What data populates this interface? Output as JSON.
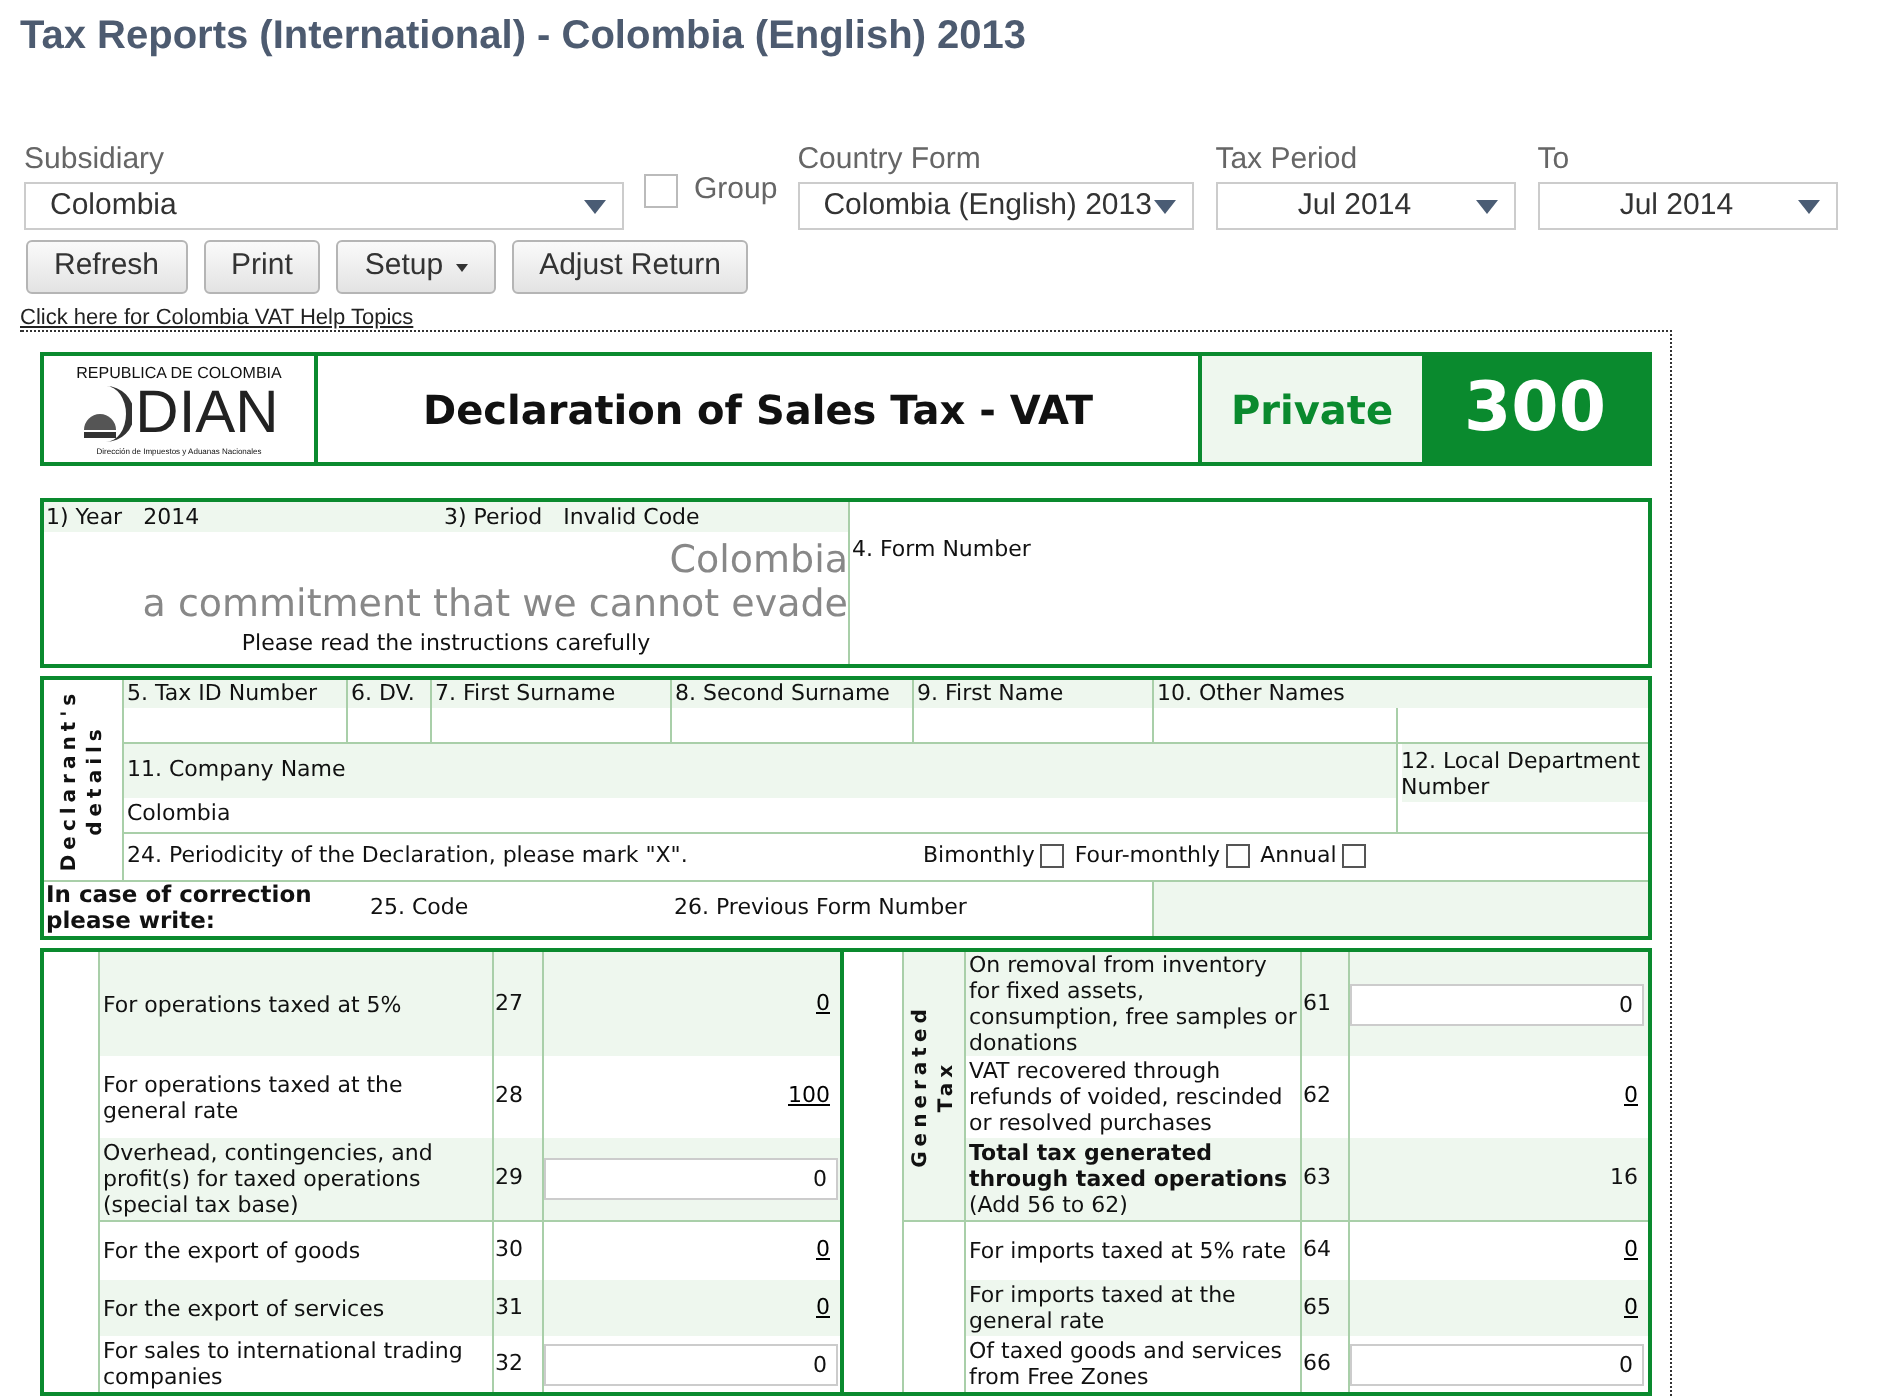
{
  "title": "Tax Reports (International) - Colombia (English) 2013",
  "filters": [
    {
      "label": "Subsidiary",
      "value": "Colombia",
      "kind": "select"
    },
    {
      "label": "Country Form",
      "value": "Colombia (English) 2013",
      "kind": "select"
    },
    {
      "label": "Tax Period",
      "value": "Jul 2014",
      "kind": "select"
    },
    {
      "label": "To",
      "value": "Jul 2014",
      "kind": "select"
    }
  ],
  "group_checkbox": {
    "label": "Group",
    "checked": false
  },
  "buttons": [
    {
      "label": "Refresh",
      "kind": "button"
    },
    {
      "label": "Print",
      "kind": "button"
    },
    {
      "label": "Setup",
      "kind": "menu"
    },
    {
      "label": "Adjust Return",
      "kind": "button"
    }
  ],
  "help_link": "Click here for Colombia VAT Help Topics",
  "form": {
    "logo": {
      "top": "REPUBLICA DE COLOMBIA",
      "name": "DIAN",
      "sub": "Dirección de Impuestos y Aduanas Nacionales"
    },
    "title": "Declaration of Sales Tax - VAT",
    "privacy": "Private",
    "number": "300",
    "section1": {
      "year_label": "1) Year",
      "year": "2014",
      "period_label": "3) Period",
      "period": "Invalid Code",
      "motto_1": "Colombia",
      "motto_2": "a commitment that we cannot evade",
      "instructions": "Please read the instructions carefully",
      "form_number_label": "4. Form Number"
    },
    "declarant": {
      "side_label_1": "Declarant's",
      "side_label_2": "details",
      "fields": [
        "5. Tax ID Number",
        "6. DV.",
        "7. First Surname",
        "8. Second Surname",
        "9. First Name",
        "10. Other Names"
      ],
      "company_label": "11. Company Name",
      "company": "Colombia",
      "local_department_label": "12. Local Department Number",
      "periodicity_label": "24. Periodicity of the Declaration, please mark \"X\".",
      "periodicity_options": [
        {
          "label": "Bimonthly",
          "checked": false
        },
        {
          "label": "Four-monthly",
          "checked": false
        },
        {
          "label": "Annual",
          "checked": false
        }
      ],
      "correction_label": "In case of correction please write:",
      "code_label": "25. Code",
      "previous_label": "26. Previous Form Number"
    },
    "left_rows": [
      {
        "label": "For operations taxed at 5%",
        "number": "27",
        "value": "0",
        "kind": "link"
      },
      {
        "label": "For operations taxed at the general rate",
        "number": "28",
        "value": "100",
        "kind": "link"
      },
      {
        "label": "Overhead, contingencies, and profit(s) for taxed operations (special tax base)",
        "number": "29",
        "value": "0",
        "kind": "input"
      },
      {
        "label": "For the export of goods",
        "number": "30",
        "value": "0",
        "kind": "link"
      },
      {
        "label": "For the export of services",
        "number": "31",
        "value": "0",
        "kind": "link"
      },
      {
        "label": "For sales to international trading companies",
        "number": "32",
        "value": "0",
        "kind": "input"
      }
    ],
    "right_side_label_1": "Generated",
    "right_side_label_2": "Tax",
    "right_rows": [
      {
        "label": "On removal from inventory for fixed assets, consumption, free samples or donations",
        "number": "61",
        "value": "0",
        "kind": "input"
      },
      {
        "label": "VAT recovered through refunds of voided, rescinded or resolved purchases",
        "number": "62",
        "value": "0",
        "kind": "link"
      },
      {
        "label": "**Total tax generated through taxed operations** (Add 56 to 62)",
        "number": "63",
        "value": "16",
        "kind": "text"
      },
      {
        "label": "For imports taxed at 5% rate",
        "number": "64",
        "value": "0",
        "kind": "link"
      },
      {
        "label": "For imports taxed at the general rate",
        "number": "65",
        "value": "0",
        "kind": "link"
      },
      {
        "label": "Of taxed goods and services from Free Zones",
        "number": "66",
        "value": "0",
        "kind": "input"
      }
    ]
  }
}
